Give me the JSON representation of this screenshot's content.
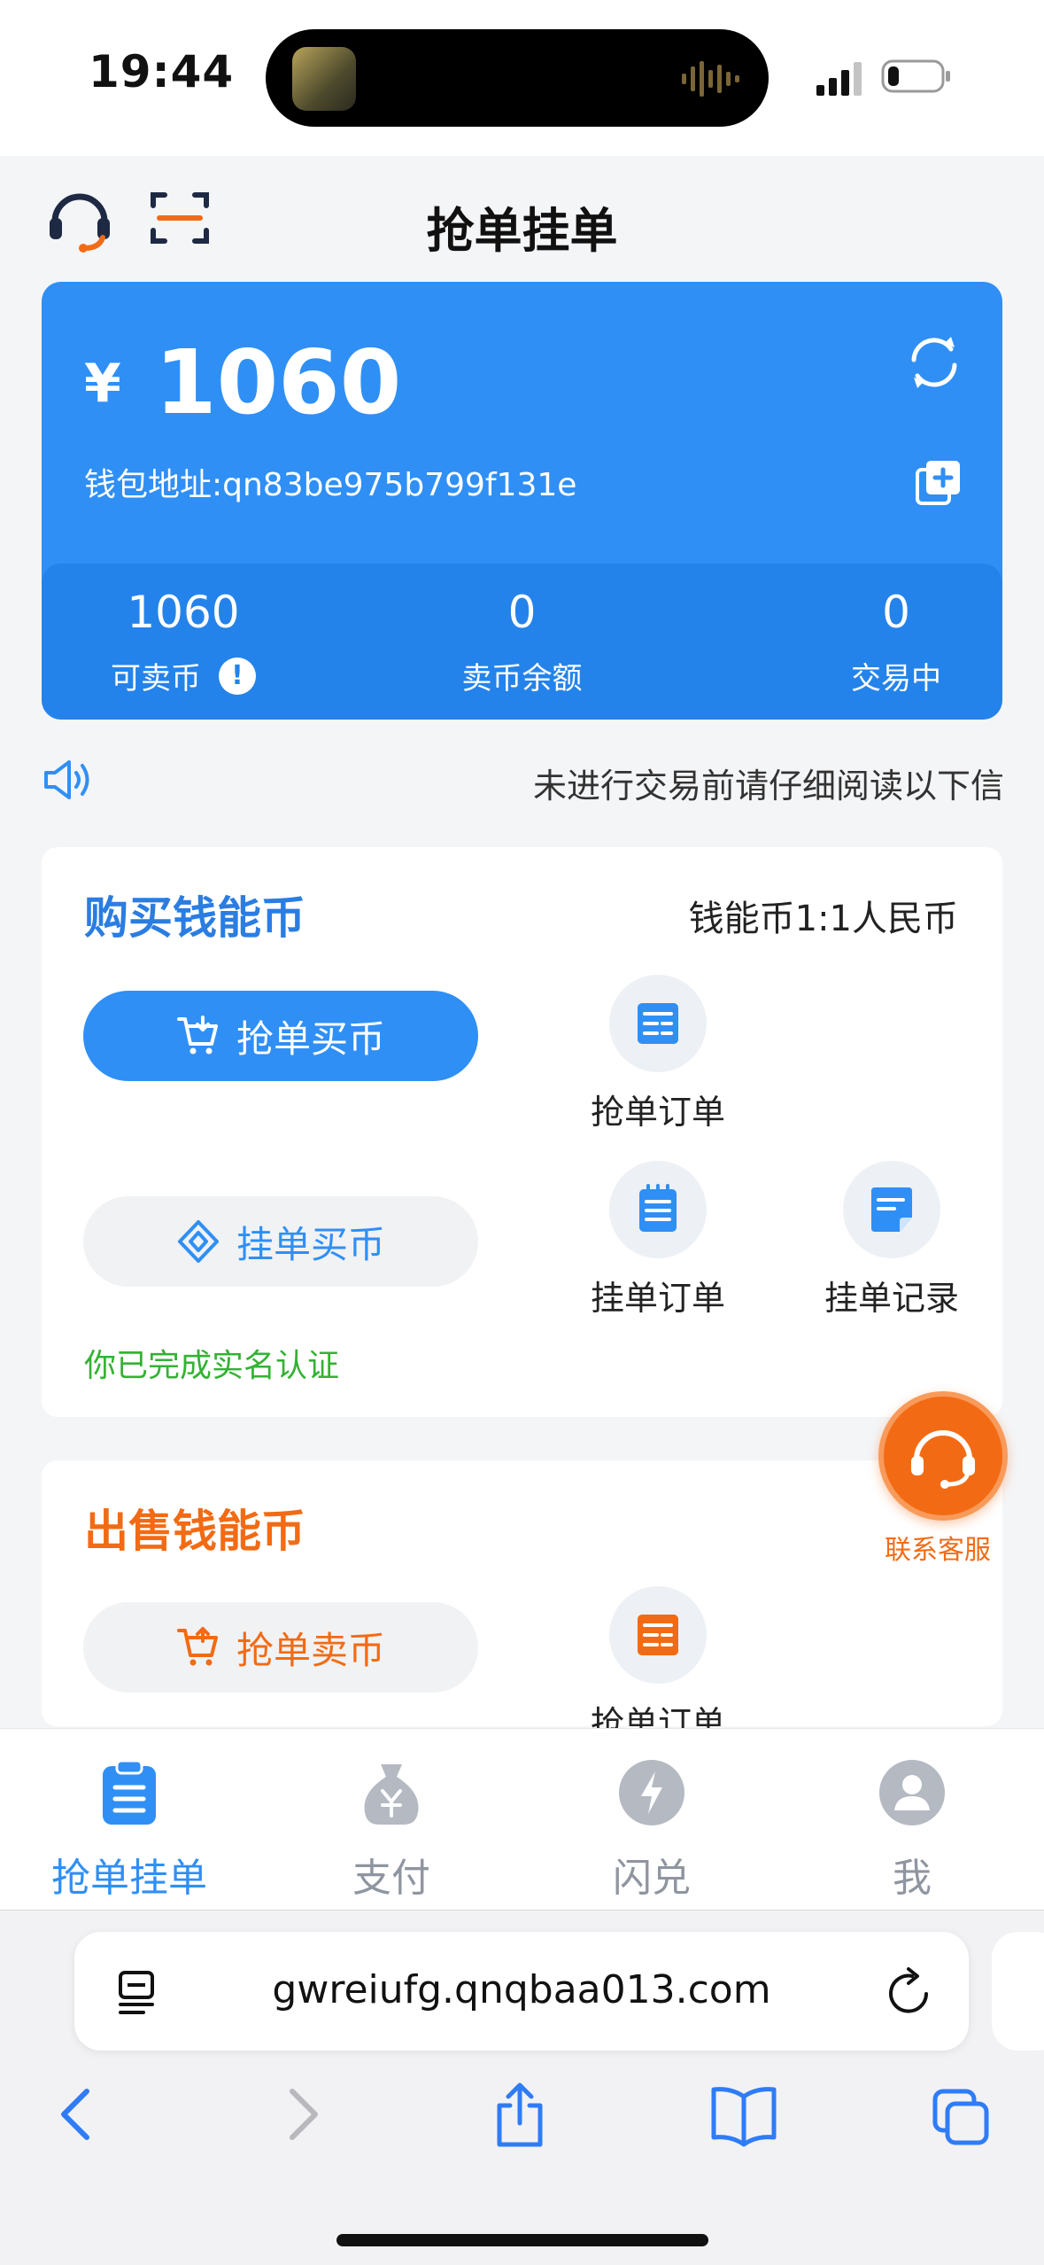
{
  "status_bar": {
    "time": "19:44"
  },
  "header": {
    "title": "抢单挂单"
  },
  "wallet": {
    "currency_symbol": "¥",
    "balance": "1060",
    "address": "钱包地址:qn83be975b799f131e",
    "stats": [
      {
        "value": "1060",
        "label": "可卖币"
      },
      {
        "value": "0",
        "label": "卖币余额"
      },
      {
        "value": "0",
        "label": "交易中"
      }
    ],
    "info_badge": "!"
  },
  "notice": {
    "text": "未进行交易前请仔细阅读以下信"
  },
  "buy_panel": {
    "title": "购买钱能币",
    "rate": "钱能币1:1人民币",
    "grab_buy_button": "抢单买币",
    "post_buy_button": "挂单买币",
    "items": [
      {
        "label": "抢单订单"
      },
      {
        "label": "挂单订单"
      },
      {
        "label": "挂单记录"
      }
    ],
    "verified_text": "你已完成实名认证"
  },
  "sell_panel": {
    "title": "出售钱能币",
    "grab_sell_button": "抢单卖币",
    "items": [
      {
        "label": "抢单订单"
      }
    ]
  },
  "float_service": {
    "label": "联系客服"
  },
  "tabbar": {
    "tabs": [
      {
        "label": "抢单挂单",
        "icon": "clipboard-icon",
        "active": true
      },
      {
        "label": "支付",
        "icon": "money-bag-icon",
        "active": false
      },
      {
        "label": "闪兑",
        "icon": "lightning-icon",
        "active": false
      },
      {
        "label": "我",
        "icon": "user-icon",
        "active": false
      }
    ]
  },
  "browser": {
    "url": "gwreiufg.qnqbaa013.com"
  },
  "colors": {
    "primary": "#2f8ff5",
    "primary_dark": "#2483ea",
    "orange": "#f26b14",
    "green": "#34b233",
    "inactive": "#8f95a0"
  }
}
